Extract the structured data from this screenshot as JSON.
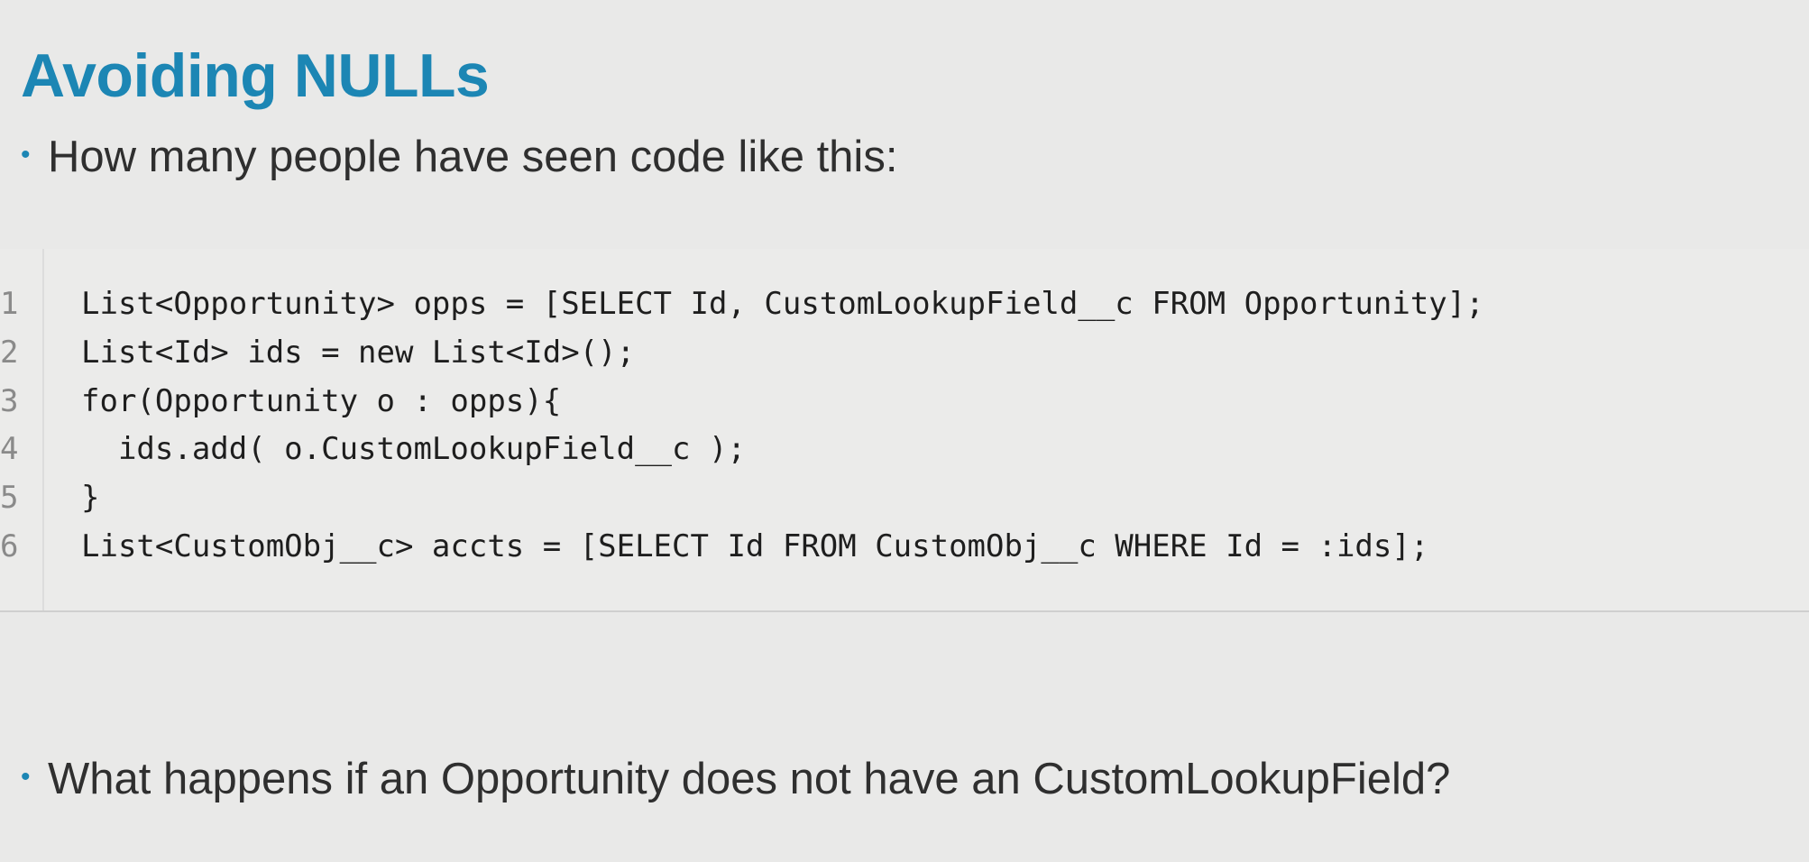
{
  "slide": {
    "title": "Avoiding NULLs",
    "bullets": [
      "How many people have seen code like this:",
      "What happens if an Opportunity does not have an CustomLookupField?"
    ],
    "bullet_glyph": "•",
    "code": {
      "lines": [
        {
          "number": "1",
          "text": "List<Opportunity> opps = [SELECT Id, CustomLookupField__c FROM Opportunity];"
        },
        {
          "number": "2",
          "text": "List<Id> ids = new List<Id>();"
        },
        {
          "number": "3",
          "text": "for(Opportunity o : opps){"
        },
        {
          "number": "4",
          "text": "  ids.add( o.CustomLookupField__c );"
        },
        {
          "number": "5",
          "text": "}"
        },
        {
          "number": "6",
          "text": "List<CustomObj__c> accts = [SELECT Id FROM CustomObj__c WHERE Id = :ids];"
        }
      ]
    }
  },
  "colors": {
    "background": "#e9e9e8",
    "title": "#1c86b4",
    "bullet_dot": "#1c86b4",
    "body_text": "#2f2f2f",
    "code_text": "#1e1e1e",
    "line_number": "#8a8a8a"
  }
}
